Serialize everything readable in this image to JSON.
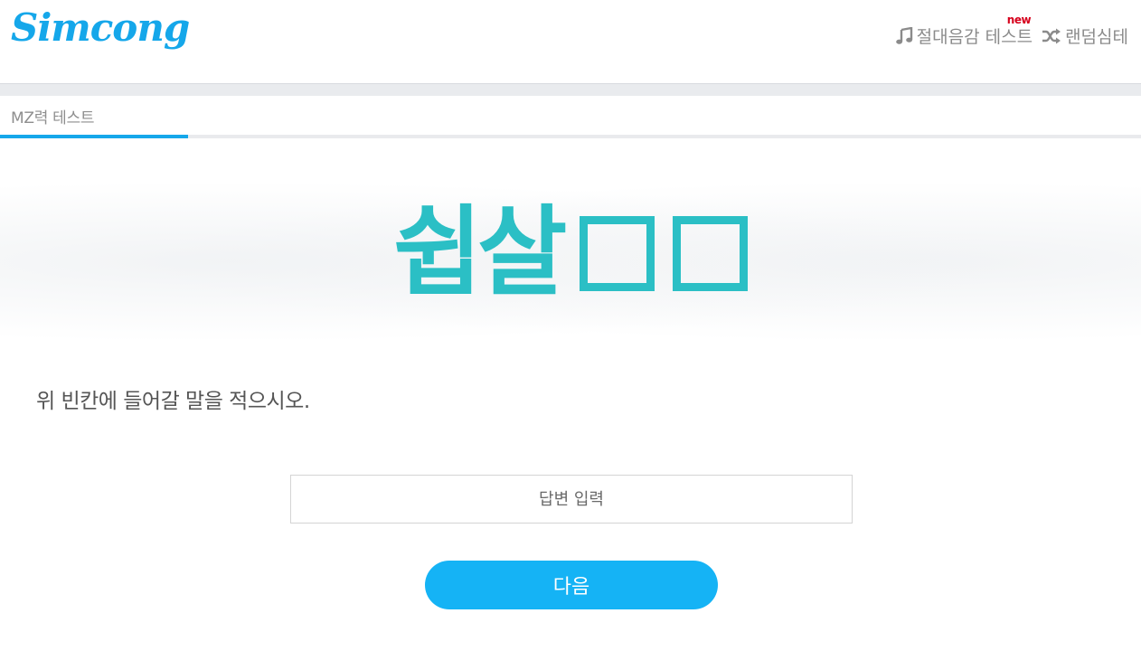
{
  "header": {
    "logo": "Simcong",
    "nav": [
      {
        "label": "절대음감 테스트",
        "icon": "music-note-icon",
        "badge": "new"
      },
      {
        "label": "랜덤심테",
        "icon": "shuffle-icon"
      }
    ]
  },
  "section": {
    "title": "MZ력 테스트"
  },
  "progress": {
    "fraction": 0.165
  },
  "quiz": {
    "image_text": "쉽살",
    "blank_count": 2,
    "question": "위 빈칸에 들어갈 말을 적으시오.",
    "answer_placeholder": "답변 입력",
    "answer_value": "",
    "next_label": "다음"
  },
  "colors": {
    "brand": "#15a7ea",
    "button": "#15b3f5",
    "quiz_text": "#2bbfc5",
    "new_badge": "#d6001c"
  }
}
